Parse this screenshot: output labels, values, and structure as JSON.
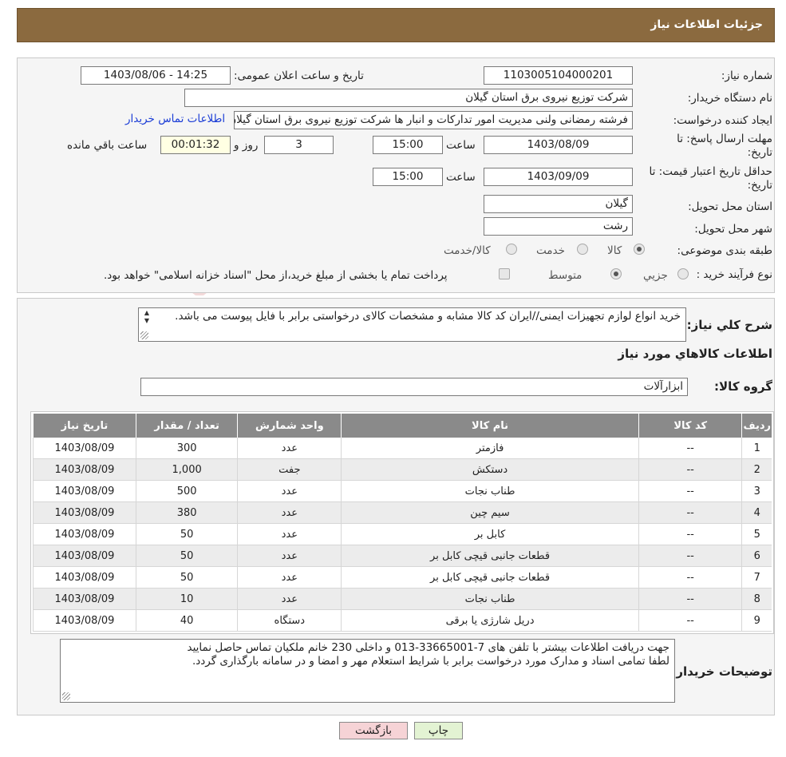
{
  "header": {
    "title": "جزئیات اطلاعات نیاز"
  },
  "form": {
    "need_number_label": "شماره نیاز:",
    "need_number": "1103005104000201",
    "announce_label": "تاریخ و ساعت اعلان عمومی:",
    "announce_value": "1403/08/06 - 14:25",
    "buyer_org_label": "نام دستگاه خریدار:",
    "buyer_org": "شرکت توزیع نیروی برق استان گیلان",
    "creator_label": "ایجاد کننده درخواست:",
    "creator": "فرشته رمضانی ولنی مدیریت امور تدارکات و انبار ها شرکت توزیع نیروی برق استان گیلان",
    "contact_link": "اطلاعات تماس خریدار",
    "deadline_label_1": "مهلت ارسال پاسخ: تا",
    "deadline_label_2": "تاریخ:",
    "deadline_date": "1403/08/09",
    "time_label": "ساعت",
    "deadline_time": "15:00",
    "days_value": "3",
    "days_label": "روز و",
    "remaining_value": "00:01:32",
    "remaining_label": "ساعت باقي مانده",
    "validity_label_1": "حداقل تاریخ اعتبار قیمت: تا",
    "validity_label_2": "تاریخ:",
    "validity_date": "1403/09/09",
    "validity_time": "15:00",
    "province_label": "استان محل تحویل:",
    "province": "گیلان",
    "city_label": "شهر محل تحویل:",
    "city": "رشت",
    "category_label": "طبقه بندی موضوعی:",
    "category_options": [
      "کالا",
      "خدمت",
      "کالا/خدمت"
    ],
    "purchase_type_label": "نوع فرآیند خرید :",
    "purchase_options": [
      "جزیي",
      "متوسط"
    ],
    "purchase_note": "پرداخت تمام یا بخشی از مبلغ خرید،از محل \"اسناد خزانه اسلامی\" خواهد بود."
  },
  "summary": {
    "label": "شرح کلي نياز:",
    "text": "خرید انواع لوازم تجهیزات ایمنی//ایران کد کالا مشابه و مشخصات کالای درخواستی برابر با فایل پیوست می باشد."
  },
  "goods": {
    "section_title": "اطلاعات کالاهاي مورد نياز",
    "group_label": "گروه کالا:",
    "group_value": "ابزارآلات",
    "columns": [
      "ردیف",
      "کد کالا",
      "نام کالا",
      "واحد شمارش",
      "تعداد / مقدار",
      "تاریخ نیاز"
    ],
    "rows": [
      [
        "1",
        "--",
        "فازمتر",
        "عدد",
        "300",
        "1403/08/09"
      ],
      [
        "2",
        "--",
        "دستکش",
        "جفت",
        "1,000",
        "1403/08/09"
      ],
      [
        "3",
        "--",
        "طناب نجات",
        "عدد",
        "500",
        "1403/08/09"
      ],
      [
        "4",
        "--",
        "سیم چین",
        "عدد",
        "380",
        "1403/08/09"
      ],
      [
        "5",
        "--",
        "کابل بر",
        "عدد",
        "50",
        "1403/08/09"
      ],
      [
        "6",
        "--",
        "قطعات جانبی قیچی کابل بر",
        "عدد",
        "50",
        "1403/08/09"
      ],
      [
        "7",
        "--",
        "قطعات جانبی قیچی کابل بر",
        "عدد",
        "50",
        "1403/08/09"
      ],
      [
        "8",
        "--",
        "طناب نجات",
        "عدد",
        "10",
        "1403/08/09"
      ],
      [
        "9",
        "--",
        "دریل شارژی یا برقی",
        "دستگاه",
        "40",
        "1403/08/09"
      ]
    ]
  },
  "buyer_notes": {
    "label": "توضیحات خریدار:",
    "line1": "جهت دریافت اطلاعات بیشتر با تلفن های 7-33665001-013 و داخلی 230 خانم ملکیان تماس حاصل نمایید",
    "line2": "لطفا تمامی اسناد و مدارک مورد درخواست برابر با شرایط استعلام مهر و امضا و در سامانه بارگذاری گردد."
  },
  "buttons": {
    "print": "چاپ",
    "back": "بازگشت"
  },
  "watermark": {
    "text": "AriaTender.neT"
  },
  "colors": {
    "header_bg": "#8b6a3f",
    "table_header": "#8a8a8a",
    "back_btn": "#f6d3d6",
    "print_btn": "#e3f3d3",
    "link": "#1a3cd6"
  }
}
